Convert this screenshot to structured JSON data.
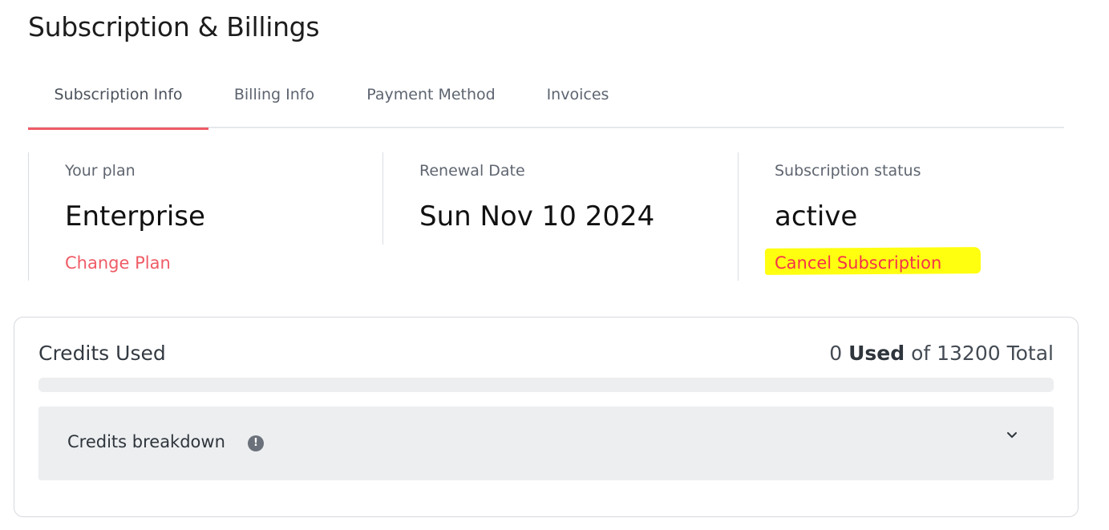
{
  "page": {
    "title": "Subscription & Billings"
  },
  "tabs": [
    {
      "label": "Subscription Info",
      "active": true
    },
    {
      "label": "Billing Info",
      "active": false
    },
    {
      "label": "Payment Method",
      "active": false
    },
    {
      "label": "Invoices",
      "active": false
    }
  ],
  "plan": {
    "label": "Your plan",
    "value": "Enterprise",
    "action": "Change Plan"
  },
  "renewal": {
    "label": "Renewal Date",
    "value": "Sun Nov 10 2024"
  },
  "status": {
    "label": "Subscription status",
    "value": "active",
    "action": "Cancel Subscription"
  },
  "credits": {
    "title": "Credits Used",
    "used_value": "0",
    "used_label": "Used",
    "of_text": "of",
    "total_text": "13200 Total",
    "used_fraction": 0,
    "breakdown_label": "Credits breakdown",
    "info_icon": "info-icon",
    "expand_icon": "chevron-down-icon"
  },
  "colors": {
    "accent": "#ef5b66",
    "highlight": "#ffff10",
    "panel_bg": "#eceef0"
  }
}
